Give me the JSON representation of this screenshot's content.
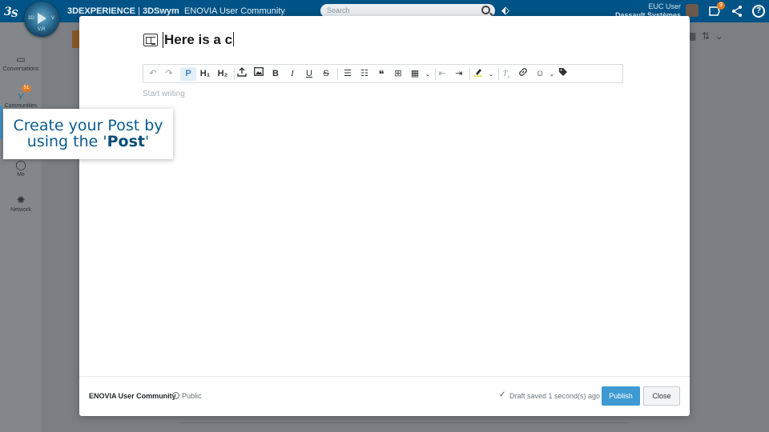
{
  "topbar": {
    "brand_bold": "3DEXPERIENCE",
    "brand_separator": " | ",
    "app_bold": "3DSwym",
    "community": "ENOVIA User Community",
    "search_placeholder": "Search",
    "compass_label_left": "3D",
    "compass_label_right": "V",
    "compass_label_bottom": "V,R",
    "user_name": "EUC User",
    "user_org": "Dassault Systèmes",
    "notifications_count": "9",
    "help_label": "?"
  },
  "sidebar": {
    "items": [
      {
        "label": "Conversations",
        "icon": "conversations-icon"
      },
      {
        "label": "Communities",
        "icon": "communities-icon",
        "badge": "51"
      },
      {
        "label": "Me",
        "icon": "person-icon"
      },
      {
        "label": "Network",
        "icon": "network-icon"
      }
    ]
  },
  "callout": {
    "line1": "Create your Post by",
    "line2_prefix": "using the '",
    "line2_bold": "Post",
    "line2_suffix": "'"
  },
  "editor": {
    "title_text": "Here is a c",
    "body_placeholder": "Start writing",
    "toolbar": {
      "undo": "↶",
      "redo": "↷",
      "paragraph": "P",
      "heading1": "H₁",
      "heading2": "H₂",
      "bold": "B",
      "italic": "I",
      "underline": "U",
      "strike": "S",
      "blockquote": "❝"
    }
  },
  "footer": {
    "community_name": "ENOVIA User Community",
    "visibility": "Public",
    "draft_status": "Draft saved 1 second(s) ago",
    "publish_label": "Publish",
    "close_label": "Close"
  },
  "colors": {
    "topbar": "#005386",
    "accent": "#3e9ad2",
    "callout_text": "#0b5c8f",
    "badge": "#e07b22"
  }
}
